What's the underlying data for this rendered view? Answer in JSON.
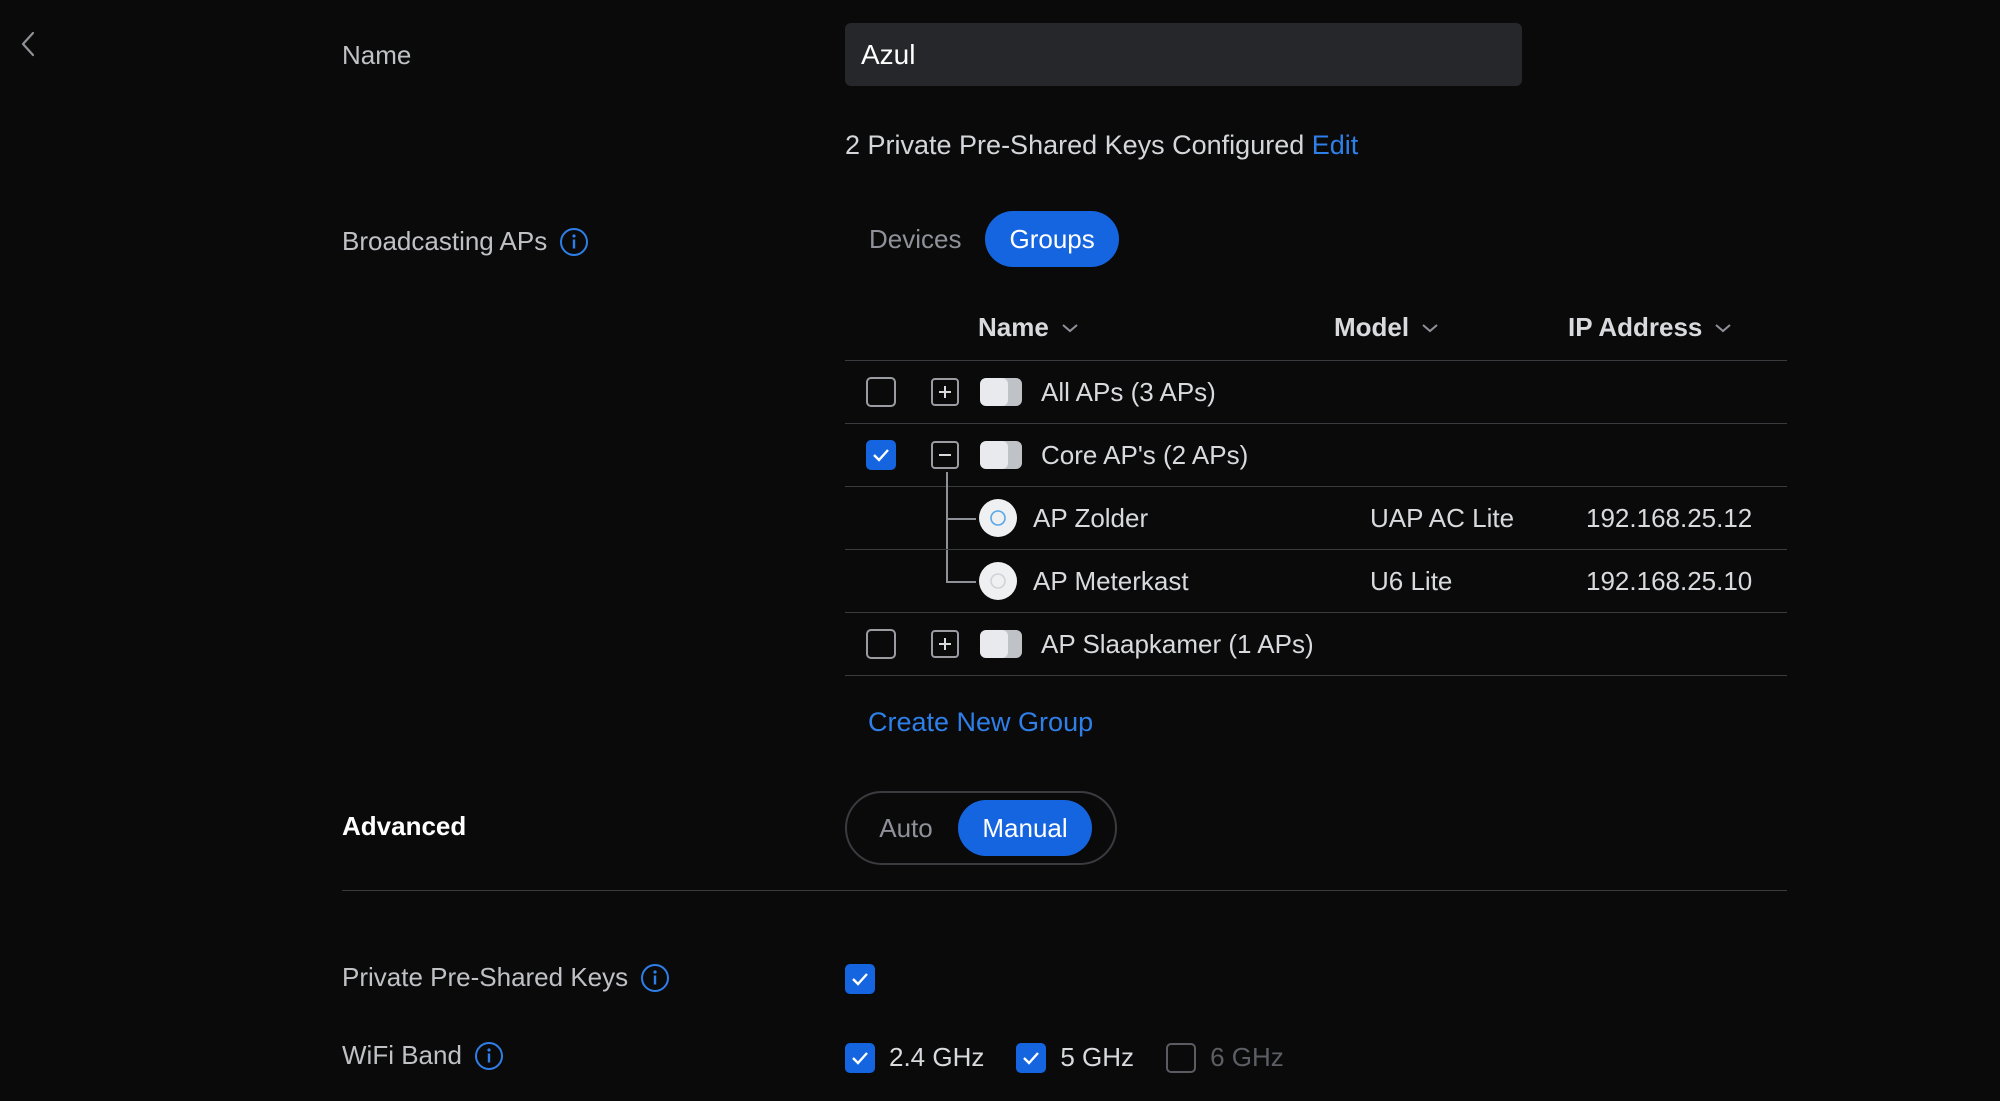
{
  "form": {
    "name_label": "Name",
    "name_value": "Azul",
    "keys_text": "2 Private Pre-Shared Keys Configured",
    "keys_edit": "Edit",
    "broadcasting_label": "Broadcasting APs",
    "tabs": {
      "devices": "Devices",
      "groups": "Groups",
      "active": "Groups"
    },
    "table": {
      "headers": {
        "name": "Name",
        "model": "Model",
        "ip": "IP Address"
      },
      "groups": [
        {
          "label": "All APs (3 APs)",
          "checked": false,
          "expanded": false
        },
        {
          "label": "Core AP's (2 APs)",
          "checked": true,
          "expanded": true
        },
        {
          "label": "AP Slaapkamer (1 APs)",
          "checked": false,
          "expanded": false
        }
      ],
      "devices": [
        {
          "name": "AP Zolder",
          "model": "UAP AC Lite",
          "ip": "192.168.25.12"
        },
        {
          "name": "AP Meterkast",
          "model": "U6 Lite",
          "ip": "192.168.25.10"
        }
      ]
    },
    "create_group": "Create New Group",
    "advanced_label": "Advanced",
    "advanced_modes": {
      "auto": "Auto",
      "manual": "Manual",
      "active": "Manual"
    },
    "ppsk_label": "Private Pre-Shared Keys",
    "ppsk_checked": true,
    "wifi_band_label": "WiFi Band",
    "bands": [
      {
        "label": "2.4 GHz",
        "checked": true,
        "disabled": false
      },
      {
        "label": "5 GHz",
        "checked": true,
        "disabled": false
      },
      {
        "label": "6 GHz",
        "checked": false,
        "disabled": true
      }
    ]
  },
  "colors": {
    "background": "#0a0a0b",
    "accent": "#1565e0",
    "link": "#2f7fe8",
    "input_bg": "#26272b"
  }
}
